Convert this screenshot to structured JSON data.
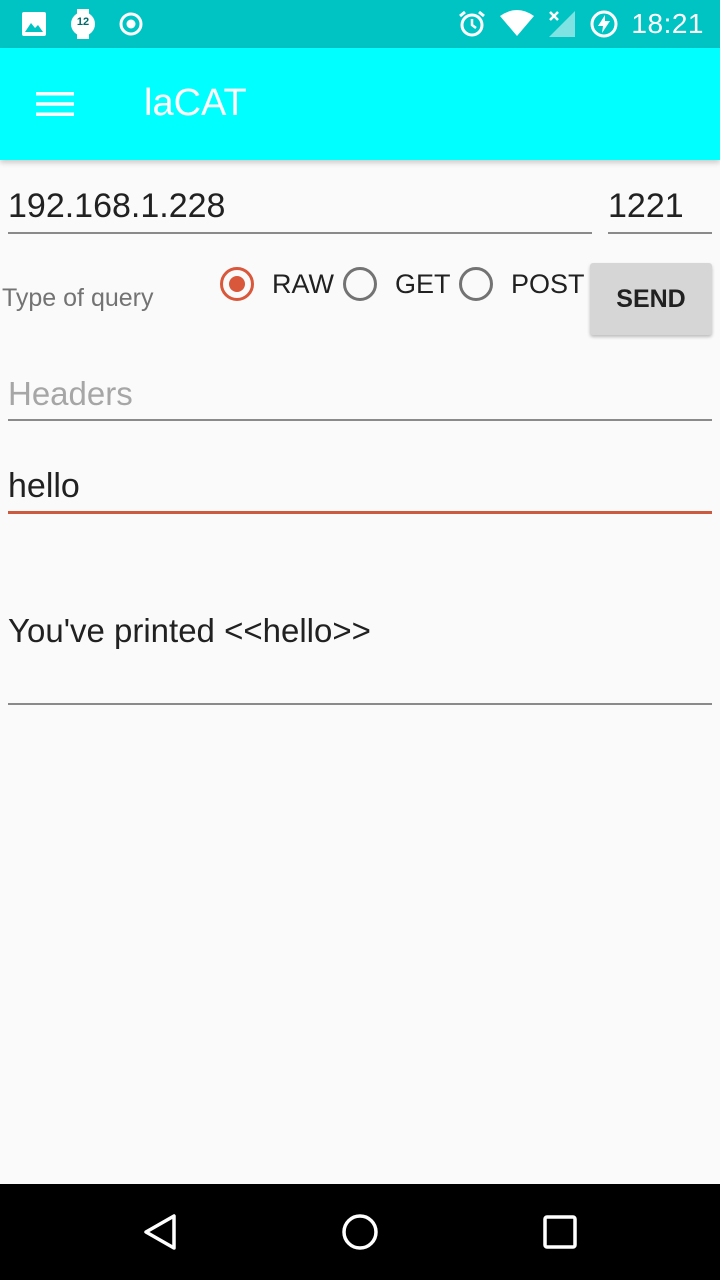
{
  "status_bar": {
    "time": "18:21",
    "notification_badge": "12",
    "icons": [
      "image-icon",
      "watch-badge-icon",
      "target-icon",
      "alarm-icon",
      "wifi-icon",
      "no-signal-icon",
      "battery-charging-icon"
    ]
  },
  "app_bar": {
    "title": "laCAT",
    "menu_icon": "hamburger-menu-icon",
    "background": "#00ffff"
  },
  "connection": {
    "ip_value": "192.168.1.228",
    "port_value": "1221"
  },
  "query": {
    "type_label": "Type of query",
    "options": [
      {
        "label": "RAW",
        "checked": true
      },
      {
        "label": "GET",
        "checked": false
      },
      {
        "label": "POST",
        "checked": false
      }
    ],
    "send_label": "SEND"
  },
  "headers": {
    "placeholder": "Headers",
    "value": ""
  },
  "message": {
    "value": "hello"
  },
  "response": {
    "text": "You've printed <<hello>>"
  },
  "colors": {
    "accent": "#d9573a",
    "status_bar": "#00c4c4"
  },
  "nav_bar": {
    "icons": [
      "back-icon",
      "home-icon",
      "recents-icon"
    ]
  }
}
